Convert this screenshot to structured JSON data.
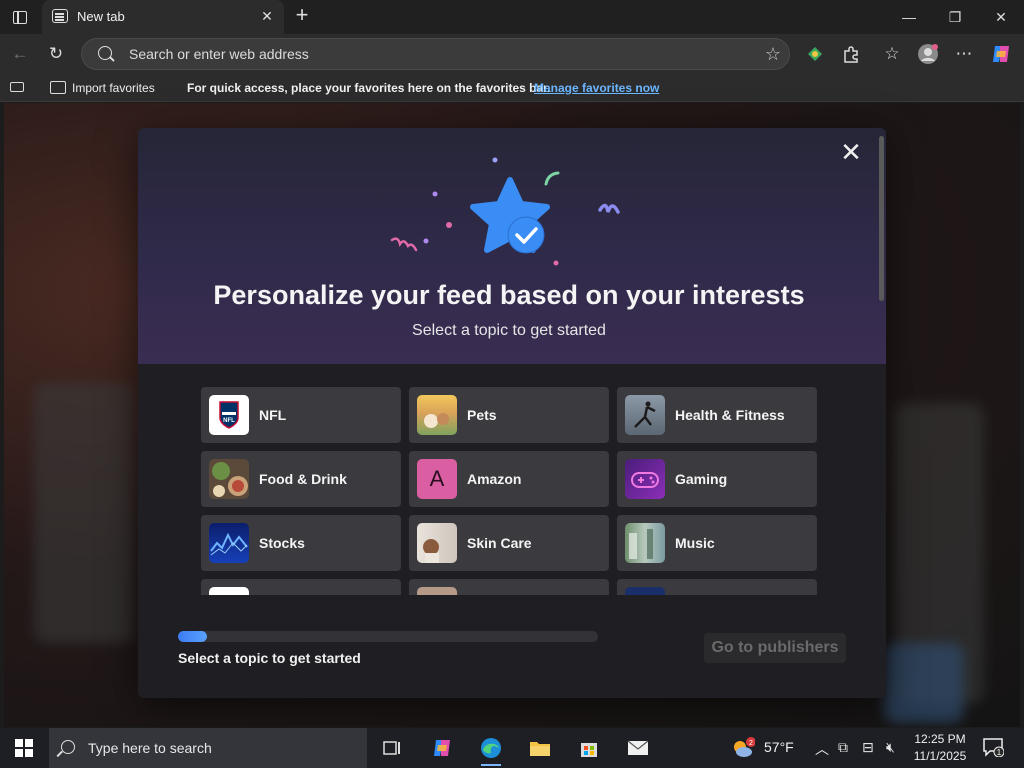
{
  "browser": {
    "tab_title": "New tab",
    "address_placeholder": "Search or enter web address"
  },
  "favorites_bar": {
    "import_label": "Import favorites",
    "hint": "For quick access, place your favorites here on the favorites bar.",
    "manage_link": "Manage favorites now"
  },
  "modal": {
    "title": "Personalize your feed based on your interests",
    "subtitle": "Select a topic to get started",
    "topics": [
      {
        "label": "NFL",
        "icon": "nfl-logo-icon"
      },
      {
        "label": "Pets",
        "icon": "pets-thumbnail"
      },
      {
        "label": "Health & Fitness",
        "icon": "health-fitness-thumbnail"
      },
      {
        "label": "Food & Drink",
        "icon": "food-drink-thumbnail"
      },
      {
        "label": "Amazon",
        "icon": "amazon-letter-icon",
        "letter": "A"
      },
      {
        "label": "Gaming",
        "icon": "gamepad-thumbnail"
      },
      {
        "label": "Stocks",
        "icon": "stocks-thumbnail"
      },
      {
        "label": "Skin Care",
        "icon": "skin-care-thumbnail"
      },
      {
        "label": "Music",
        "icon": "music-thumbnail"
      }
    ],
    "progress": {
      "fraction": 0.07,
      "label": "Select a topic to get started"
    },
    "next_button": "Go to publishers"
  },
  "taskbar": {
    "search_placeholder": "Type here to search",
    "weather_temp": "57°F",
    "weather_badge": "2",
    "clock_time": "12:25 PM",
    "clock_date": "11/1/2025",
    "notification_count": "1"
  },
  "colors": {
    "accent": "#3d7bf2",
    "link": "#6cb6ff",
    "modal_bg": "#1f1f23",
    "topic_bg": "#3b3b3f"
  }
}
